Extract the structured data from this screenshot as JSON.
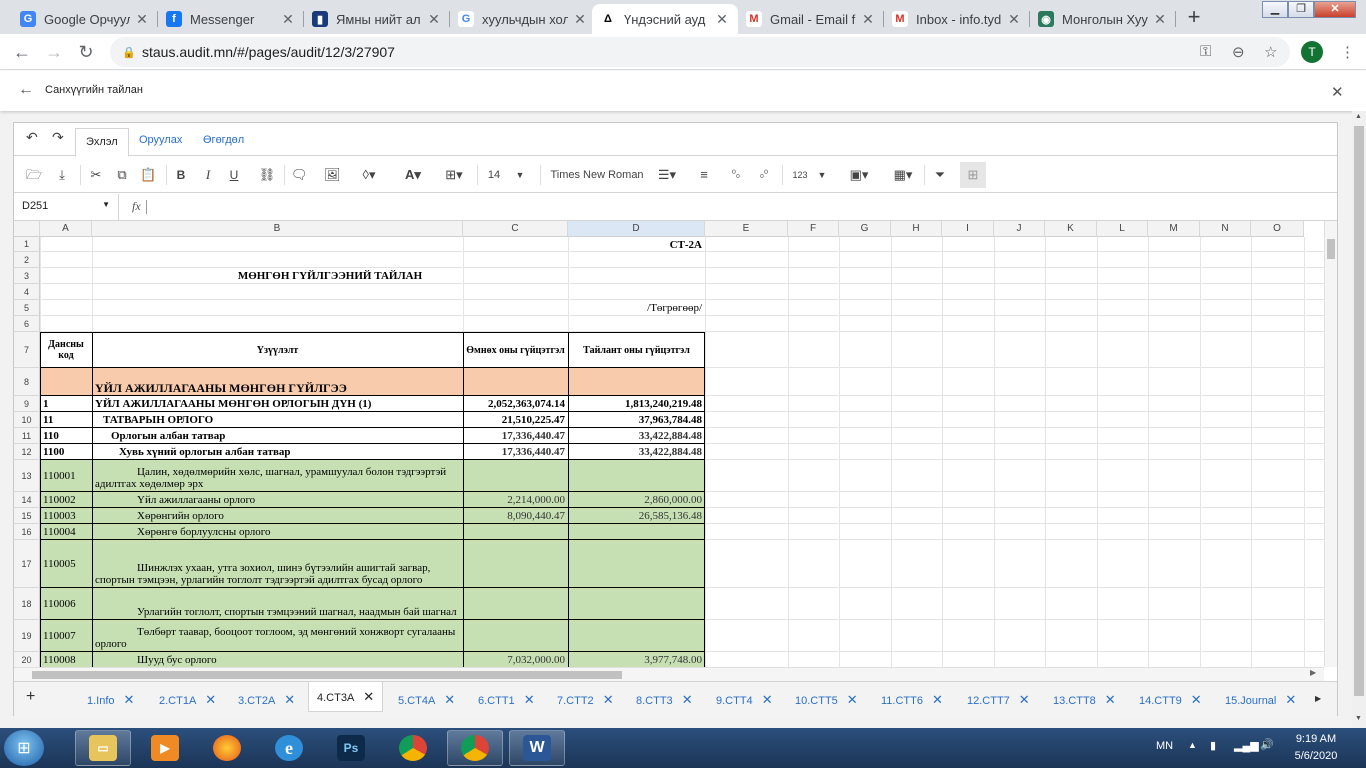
{
  "browser": {
    "tabs": [
      {
        "title": "Google Орчуулга",
        "icon": "google-translate-icon",
        "color": "#4285f4",
        "glyph": "G"
      },
      {
        "title": "Messenger",
        "icon": "facebook-icon",
        "color": "#1877f2",
        "glyph": "f"
      },
      {
        "title": "Ямны нийт ал",
        "icon": "government-emblem-icon",
        "color": "#1a3a7a",
        "glyph": "▮"
      },
      {
        "title": "хуульчдын хол",
        "icon": "google-icon",
        "color": "#ffffff",
        "glyph": "G"
      },
      {
        "title": "Үндэсний ауд",
        "icon": "audit-logo-icon",
        "color": "#ffffff",
        "glyph": "Δ"
      },
      {
        "title": "Gmail - Email fr",
        "icon": "gmail-icon",
        "color": "#ffffff",
        "glyph": "M"
      },
      {
        "title": "Inbox - info.tyd",
        "icon": "gmail-icon",
        "color": "#ffffff",
        "glyph": "M"
      },
      {
        "title": "Монголын Хуу",
        "icon": "mongolia-site-icon",
        "color": "#2b7a5e",
        "glyph": "◉"
      }
    ],
    "url": "staus.audit.mn/#/pages/audit/12/3/27907",
    "profile_initial": "T"
  },
  "page": {
    "title": "Санхүүгийн тайлан"
  },
  "ribbon": {
    "tabs": [
      "Эхлэл",
      "Оруулах",
      "Өгөгдөл"
    ],
    "font_size": "14",
    "font_name": "Times New Roman",
    "number_format": "123"
  },
  "formula_bar": {
    "cell_ref": "D251",
    "fx": "fx",
    "value": ""
  },
  "grid": {
    "columns": [
      "A",
      "B",
      "C",
      "D",
      "E",
      "F",
      "G",
      "H",
      "I",
      "J",
      "K",
      "L",
      "M",
      "N",
      "O"
    ],
    "rows": [
      {
        "n": "1",
        "a": "",
        "b": "",
        "c": "",
        "d": "СТ-2А"
      },
      {
        "n": "2",
        "a": "",
        "b": "",
        "c": "",
        "d": ""
      },
      {
        "n": "3",
        "a": "",
        "b": "МӨНГӨН ГҮЙЛГЭЭНИЙ ТАЙЛАН",
        "c": "",
        "d": ""
      },
      {
        "n": "4",
        "a": "",
        "b": "",
        "c": "",
        "d": ""
      },
      {
        "n": "5",
        "a": "",
        "b": "",
        "c": "",
        "d": "/Төгрөгөөр/"
      },
      {
        "n": "6",
        "a": "",
        "b": "",
        "c": "",
        "d": ""
      },
      {
        "n": "7",
        "a": "Дансны код",
        "b": "Үзүүлэлт",
        "c": "Өмнөх оны гүйцэтгэл",
        "d": "Тайлант оны гүйцэтгэл"
      },
      {
        "n": "8",
        "a": "",
        "b": "ҮЙЛ АЖИЛЛАГААНЫ МӨНГӨН ГҮЙЛГЭЭ",
        "c": "",
        "d": ""
      },
      {
        "n": "9",
        "a": "1",
        "b": "ҮЙЛ АЖИЛЛАГААНЫ МӨНГӨН ОРЛОГЫН ДҮН (1)",
        "c": "2,052,363,074.14",
        "d": "1,813,240,219.48"
      },
      {
        "n": "10",
        "a": "11",
        "b": "ТАТВАРЫН ОРЛОГО",
        "c": "21,510,225.47",
        "d": "37,963,784.48"
      },
      {
        "n": "11",
        "a": "110",
        "b": "Орлогын албан татвар",
        "c": "17,336,440.47",
        "d": "33,422,884.48"
      },
      {
        "n": "12",
        "a": "1100",
        "b": "Хувь хүний орлогын албан татвар",
        "c": "17,336,440.47",
        "d": "33,422,884.48"
      },
      {
        "n": "13",
        "a": "110001",
        "b": "Цалин, хөдөлмөрийн хөлс, шагнал, урамшуулал болон тэдгээртэй адилтгах хөдөлмөр эрх",
        "c": "",
        "d": ""
      },
      {
        "n": "14",
        "a": "110002",
        "b": "Үйл ажиллагааны орлого",
        "c": "2,214,000.00",
        "d": "2,860,000.00"
      },
      {
        "n": "15",
        "a": "110003",
        "b": "Хөрөнгийн орлого",
        "c": "8,090,440.47",
        "d": "26,585,136.48"
      },
      {
        "n": "16",
        "a": "110004",
        "b": "Хөрөнгө борлуулсны орлого",
        "c": "",
        "d": ""
      },
      {
        "n": "17",
        "a": "110005",
        "b": "Шинжлэх ухаан, утга зохиол, шинэ бүтээлийн ашигтай загвар, спортын тэмцээн, урлагийн тоглолт тэдгээртэй адилтгах бусад орлого",
        "c": "",
        "d": ""
      },
      {
        "n": "18",
        "a": "110006",
        "b": "Урлагийн тоглолт, спортын тэмцээний шагнал, наадмын бай шагнал",
        "c": "",
        "d": ""
      },
      {
        "n": "19",
        "a": "110007",
        "b": "Төлбөрт таавар, бооцоот тоглоом, эд мөнгөний хонжворт сугалааны орлого",
        "c": "",
        "d": ""
      },
      {
        "n": "20",
        "a": "110008",
        "b": "Шууд бус орлого",
        "c": "7,032,000.00",
        "d": "3,977,748.00"
      }
    ]
  },
  "sheets": [
    "1.Info",
    "2.CT1A",
    "3.CT2A",
    "4.CT3A",
    "5.CT4A",
    "6.CTT1",
    "7.CTT2",
    "8.CTT3",
    "9.CTT4",
    "10.CTT5",
    "11.CTT6",
    "12.CTT7",
    "13.CTT8",
    "14.CTT9",
    "15.Journal"
  ],
  "taskbar": {
    "language": "MN",
    "time": "9:19 AM",
    "date": "5/6/2020"
  },
  "colors": {
    "header_fill": "#f8cbad",
    "green_fill": "#c6e0b4",
    "accent": "#2a6fc9"
  }
}
